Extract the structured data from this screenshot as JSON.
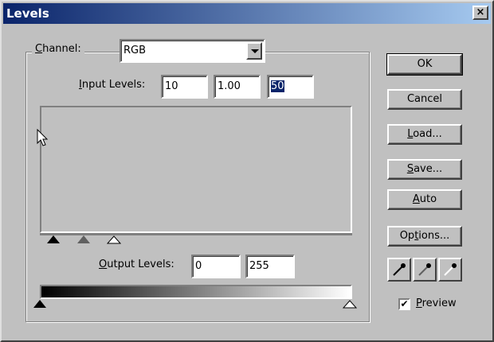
{
  "window": {
    "title": "Levels",
    "close_glyph": "×"
  },
  "channel": {
    "label_prefix": "",
    "label_ul": "C",
    "label_rest": "hannel:",
    "value": "RGB"
  },
  "input_levels": {
    "label_ul": "I",
    "label_rest": "nput Levels:",
    "black": "10",
    "gamma": "1.00",
    "white": "50"
  },
  "output_levels": {
    "label_ul": "O",
    "label_rest": "utput Levels:",
    "black": "0",
    "white": "255"
  },
  "buttons": {
    "ok": "OK",
    "cancel": "Cancel",
    "load_ul": "L",
    "load_rest": "oad...",
    "save_ul": "S",
    "save_rest": "ave...",
    "auto_ul": "A",
    "auto_rest": "uto",
    "options_pre": "Op",
    "options_ul": "t",
    "options_rest": "ions..."
  },
  "preview": {
    "checked": "✔",
    "label_ul": "P",
    "label_rest": "review"
  },
  "icons": {
    "eyedropper_black": "eyedropper-black-icon",
    "eyedropper_gray": "eyedropper-gray-icon",
    "eyedropper_white": "eyedropper-white-icon"
  }
}
